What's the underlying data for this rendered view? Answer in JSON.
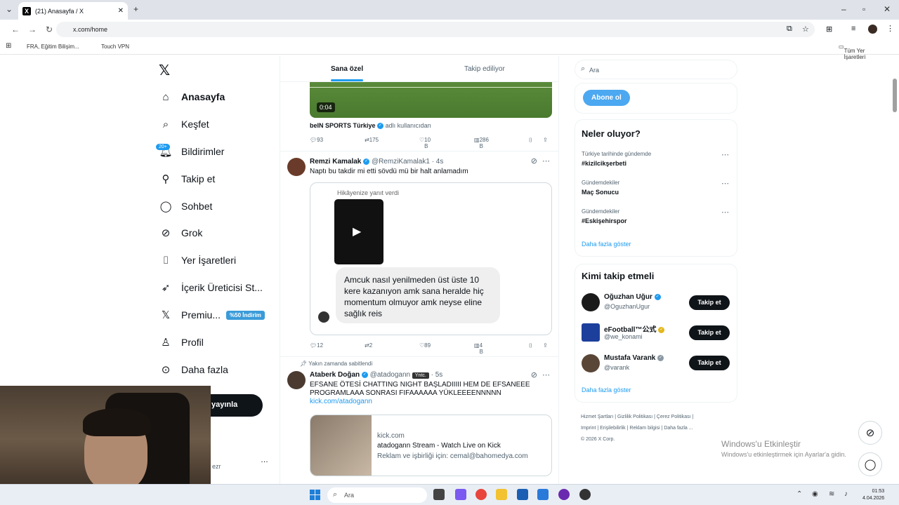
{
  "browser": {
    "tab_title": "(21) Anasayfa / X",
    "url": "x.com/home",
    "bookmarks": [
      "FRA, Eğitim Bilişim...",
      "Touch VPN"
    ],
    "all_bookmarks": "Tüm Yer İşaretleri"
  },
  "nav": {
    "items": [
      {
        "label": "Anasayfa",
        "icon": "home-icon",
        "active": true
      },
      {
        "label": "Keşfet",
        "icon": "search-icon"
      },
      {
        "label": "Bildirimler",
        "icon": "bell-icon",
        "badge": "20+"
      },
      {
        "label": "Takip et",
        "icon": "person-add-icon"
      },
      {
        "label": "Sohbet",
        "icon": "chat-icon"
      },
      {
        "label": "Grok",
        "icon": "grok-icon"
      },
      {
        "label": "Yer İşaretleri",
        "icon": "bookmark-icon"
      },
      {
        "label": "İçerik Üreticisi St...",
        "icon": "rocket-icon"
      },
      {
        "label": "Premiu...",
        "icon": "x-icon",
        "discount": "%50 İndirim"
      },
      {
        "label": "Profil",
        "icon": "profile-icon"
      },
      {
        "label": "Daha fazla",
        "icon": "more-icon"
      }
    ],
    "live_button": "yayınla",
    "account_suffix": "ezr"
  },
  "feed": {
    "tabs": [
      "Sana özel",
      "Takip ediliyor"
    ],
    "video_duration": "0:04",
    "attribution_name": "beIN SPORTS Türkiye",
    "attribution_suffix": "adlı kullanıcıdan",
    "post0_stats": {
      "replies": "93",
      "reposts": "175",
      "likes": "10 B",
      "views": "286 B"
    },
    "post1": {
      "name": "Remzi Kamalak",
      "handle": "@RemziKamalak1",
      "time": "· 4s",
      "text": "Naptı bu takdir mi etti sövdü mü bir halt anlamadım",
      "reply_label": "Hikâyenize yanıt verdi",
      "bubble_text": "Amcuk nasıl yenilmeden üst üste 10 kere kazanıyon amk sana heralde hiç momentum olmuyor amk neyse eline sağlık reis",
      "stats": {
        "replies": "12",
        "reposts": "2",
        "likes": "89",
        "views": "4 B"
      }
    },
    "pinned_label": "Yakın zamanda sabitlendi",
    "post2": {
      "name": "Ataberk Doğan",
      "handle": "@atadogann",
      "badge": "Yntc.",
      "time": "· 5s",
      "text": "EFSANE ÖTESİ CHATTING NIGHT BAŞLADIIIII HEM DE EFSANEEE PROGRAMLAAA SONRASI FIFAAAAAA YÜKLEEEENNNNN",
      "link": "kick.com/atadogann",
      "card_domain": "kick.com",
      "card_title": "atadogann Stream - Watch Live on Kick",
      "card_desc": "Reklam ve işbirliği için: cemal@bahomedya.com"
    }
  },
  "sidebar": {
    "search_placeholder": "Ara",
    "subscribe_label": "Abone ol",
    "trends_title": "Neler oluyor?",
    "trends": [
      {
        "sub": "Türkiye tarihinde gündemde",
        "main": "#kizilcikşerbeti"
      },
      {
        "sub": "Gündemdekiler",
        "main": "Maç Sonucu"
      },
      {
        "sub": "Gündemdekiler",
        "main": "#Eskişehirspor"
      }
    ],
    "show_more": "Daha fazla göster",
    "who_title": "Kimi takip etmeli",
    "who": [
      {
        "name": "Oğuzhan Uğur",
        "handle": "@OguzhanUgur",
        "button": "Takip et",
        "color": "#1a1a1a"
      },
      {
        "name": "eFootball™公式",
        "handle": "@we_konami",
        "button": "Takip et",
        "color": "#1c3f9c"
      },
      {
        "name": "Mustafa Varank",
        "handle": "@varank",
        "button": "Takip et",
        "color": "#5a4636"
      }
    ],
    "who_show_more": "Daha fazla göster",
    "footer": [
      "Hizmet Şartları",
      "Gizlilik Politikası",
      "Çerez Politikası",
      "Imprint",
      "Erişilebilirlik",
      "Reklam bilgisi",
      "Daha fazla ...",
      "© 2026 X Corp."
    ]
  },
  "windows": {
    "activate_title": "Windows'u Etkinleştir",
    "activate_sub": "Windows'u etkinleştirmek için Ayarlar'a gidin.",
    "search": "Ara",
    "time": "01:53",
    "date": "4.04.2026"
  }
}
